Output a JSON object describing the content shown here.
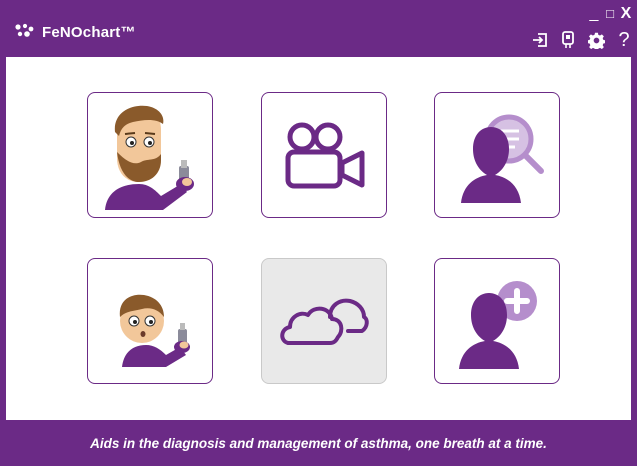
{
  "app": {
    "title": "FeNOchart™",
    "tagline": "Aids in the diagnosis and management of asthma, one breath at a time."
  },
  "window_controls": {
    "minimize": "_",
    "maximize": "□",
    "close": "X"
  },
  "toolbar": {
    "help": "?",
    "icons": [
      "login-icon",
      "device-icon",
      "settings-gear-icon",
      "help-icon"
    ]
  },
  "tiles": [
    {
      "name": "adult-test-button",
      "icon": "adult-with-inhaler-icon",
      "enabled": true
    },
    {
      "name": "video-button",
      "icon": "video-camera-icon",
      "enabled": true
    },
    {
      "name": "search-patient-button",
      "icon": "patient-search-icon",
      "enabled": true
    },
    {
      "name": "child-test-button",
      "icon": "child-with-inhaler-icon",
      "enabled": true
    },
    {
      "name": "cloud-sync-button",
      "icon": "cloud-icon",
      "enabled": false
    },
    {
      "name": "add-patient-button",
      "icon": "add-patient-icon",
      "enabled": true
    }
  ],
  "colors": {
    "brand_purple": "#6b2a86",
    "light_purple": "#b58ecc",
    "disabled_bg": "#e9e9e9",
    "skin": "#f2c79a",
    "hair": "#8a5a2b"
  }
}
